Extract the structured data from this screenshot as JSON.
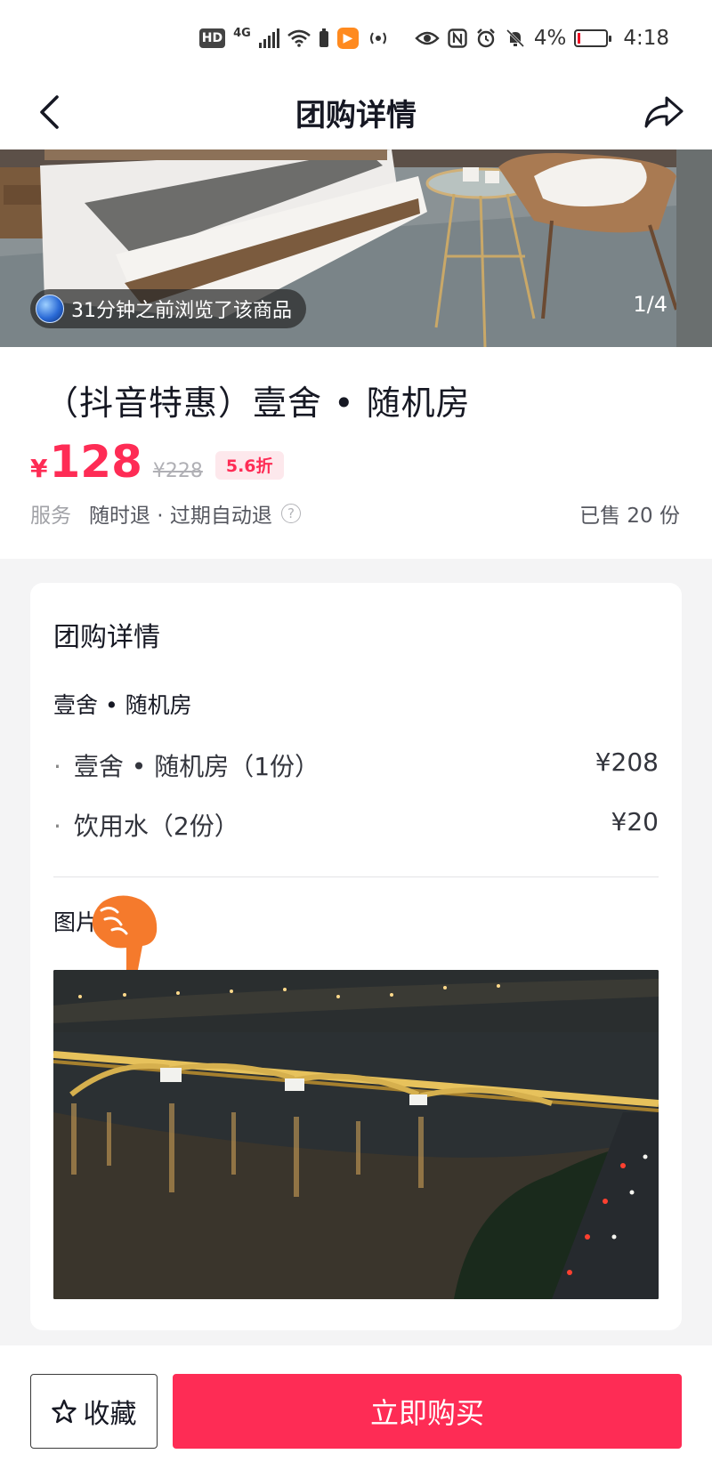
{
  "status_bar": {
    "hd_label": "HD",
    "network_label": "4G",
    "battery_percent": "4%",
    "time": "4:18"
  },
  "nav": {
    "title": "团购详情",
    "back_icon": "chevron-left-icon",
    "share_icon": "share-arrow-icon"
  },
  "gallery": {
    "browse_notice": "31分钟之前浏览了该商品",
    "page_counter": "1/4"
  },
  "product": {
    "title": "（抖音特惠）壹舍 • 随机房",
    "currency": "¥",
    "price": "128",
    "original_price": "¥228",
    "discount": "5.6折",
    "service_label": "服务",
    "service_text": "随时退 · 过期自动退",
    "help_icon_text": "?",
    "sold_text": "已售 20 份"
  },
  "details": {
    "title": "团购详情",
    "package_name": "壹舍 • 随机房",
    "items": [
      {
        "name": "壹舍 • 随机房（1份）",
        "price": "¥208"
      },
      {
        "name": "饮用水（2份）",
        "price": "¥20"
      }
    ],
    "photos_label": "图片"
  },
  "bottom_bar": {
    "favorite_label": "收藏",
    "buy_label": "立即购买"
  },
  "colors": {
    "accent": "#fe2c55",
    "discount_bg": "#fde8ec",
    "page_bg": "#f4f4f5"
  }
}
